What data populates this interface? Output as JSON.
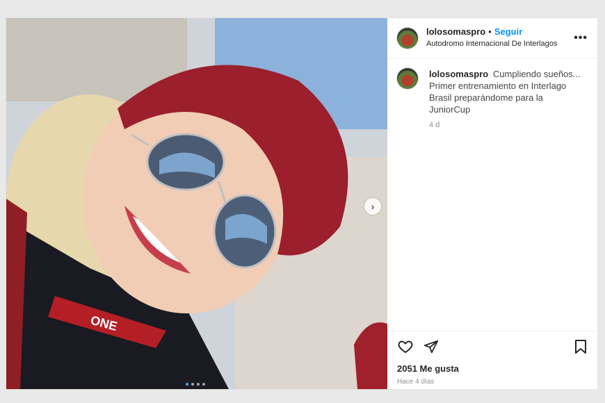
{
  "post": {
    "username": "lolosomaspro",
    "separator": "•",
    "follow_label": "Seguir",
    "location": "Autodromo Internacional De Interlagos",
    "more_label": "•••",
    "caption_username": "lolosomaspro",
    "caption_text": "Cumpliendo sueños... Primer entrenamiento en Interlago Brasil preparándome para la JuniorCup",
    "caption_time": "4 d",
    "likes": "2051 Me gusta",
    "posted_ago": "Hace 4 días"
  },
  "media": {
    "next_label": "›",
    "image_description_icon": "photo-icon",
    "carousel_count": 4,
    "carousel_active": 1,
    "jacket_text": "ONE"
  },
  "icons": {
    "like": "heart-icon",
    "share": "paper-plane-icon",
    "save": "bookmark-icon"
  }
}
